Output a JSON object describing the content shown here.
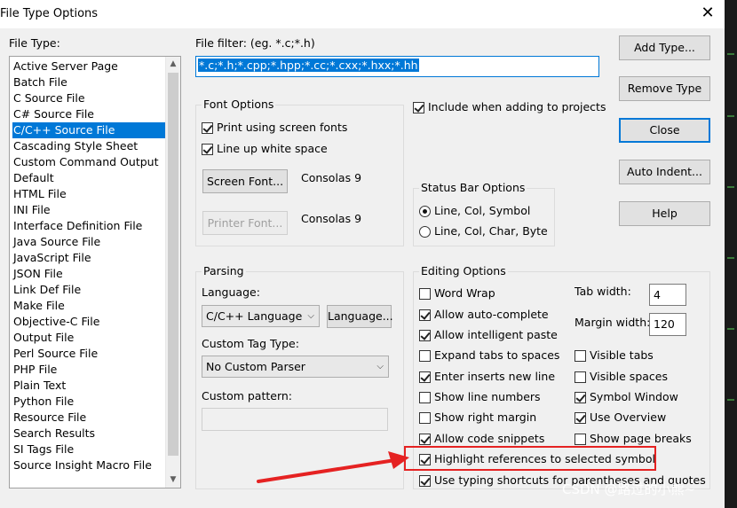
{
  "window": {
    "title": "File Type Options",
    "close_glyph": "✕"
  },
  "file_type": {
    "label": "File Type:",
    "items": [
      "Active Server Page",
      "Batch File",
      "C Source File",
      "C# Source File",
      "C/C++ Source File",
      "Cascading Style Sheet",
      "Custom Command Output",
      "Default",
      "HTML File",
      "INI File",
      "Interface Definition File",
      "Java Source File",
      "JavaScript File",
      "JSON File",
      "Link Def File",
      "Make File",
      "Objective-C File",
      "Output File",
      "Perl Source File",
      "PHP File",
      "Plain Text",
      "Python File",
      "Resource File",
      "Search Results",
      "SI Tags File",
      "Source Insight Macro File"
    ],
    "selected_index": 4
  },
  "file_filter": {
    "label": "File filter: (eg. *.c;*.h)",
    "value": "*.c;*.h;*.cpp;*.hpp;*.cc;*.cxx;*.hxx;*.hh"
  },
  "buttons": {
    "add_type": "Add Type...",
    "remove_type": "Remove Type",
    "close": "Close",
    "auto_indent": "Auto Indent...",
    "help": "Help"
  },
  "font_options": {
    "title": "Font Options",
    "print_screen_fonts": "Print using screen fonts",
    "line_up_white_space": "Line up white space",
    "screen_font_button": "Screen Font...",
    "screen_font_value": "Consolas 9",
    "printer_font_button": "Printer Font...",
    "printer_font_value": "Consolas 9"
  },
  "include_projects": "Include when adding to projects",
  "status_bar": {
    "title": "Status Bar Options",
    "opt1": "Line, Col, Symbol",
    "opt2": "Line, Col, Char, Byte"
  },
  "parsing": {
    "title": "Parsing",
    "language_label": "Language:",
    "language_value": "C/C++ Language",
    "language_button": "Language...",
    "custom_tag_label": "Custom Tag Type:",
    "custom_tag_value": "No Custom Parser",
    "custom_pattern_label": "Custom pattern:"
  },
  "editing": {
    "title": "Editing Options",
    "word_wrap": "Word Wrap",
    "auto_complete": "Allow auto-complete",
    "intelligent_paste": "Allow intelligent paste",
    "expand_tabs": "Expand tabs to spaces",
    "enter_inserts": "Enter inserts new line",
    "show_line_numbers": "Show line numbers",
    "show_right_margin": "Show right margin",
    "code_snippets": "Allow code snippets",
    "highlight_refs": "Highlight references to selected symbol",
    "typing_shortcuts": "Use typing shortcuts for parentheses and quotes",
    "tab_width_label": "Tab width:",
    "tab_width_value": "4",
    "margin_width_label": "Margin width:",
    "margin_width_value": "120",
    "visible_tabs": "Visible tabs",
    "visible_spaces": "Visible spaces",
    "symbol_window": "Symbol Window",
    "use_overview": "Use Overview",
    "show_page_breaks": "Show page breaks"
  },
  "annotation": {
    "highlight_color": "#e52222"
  },
  "watermark": "CSDN @路过的小熊~"
}
